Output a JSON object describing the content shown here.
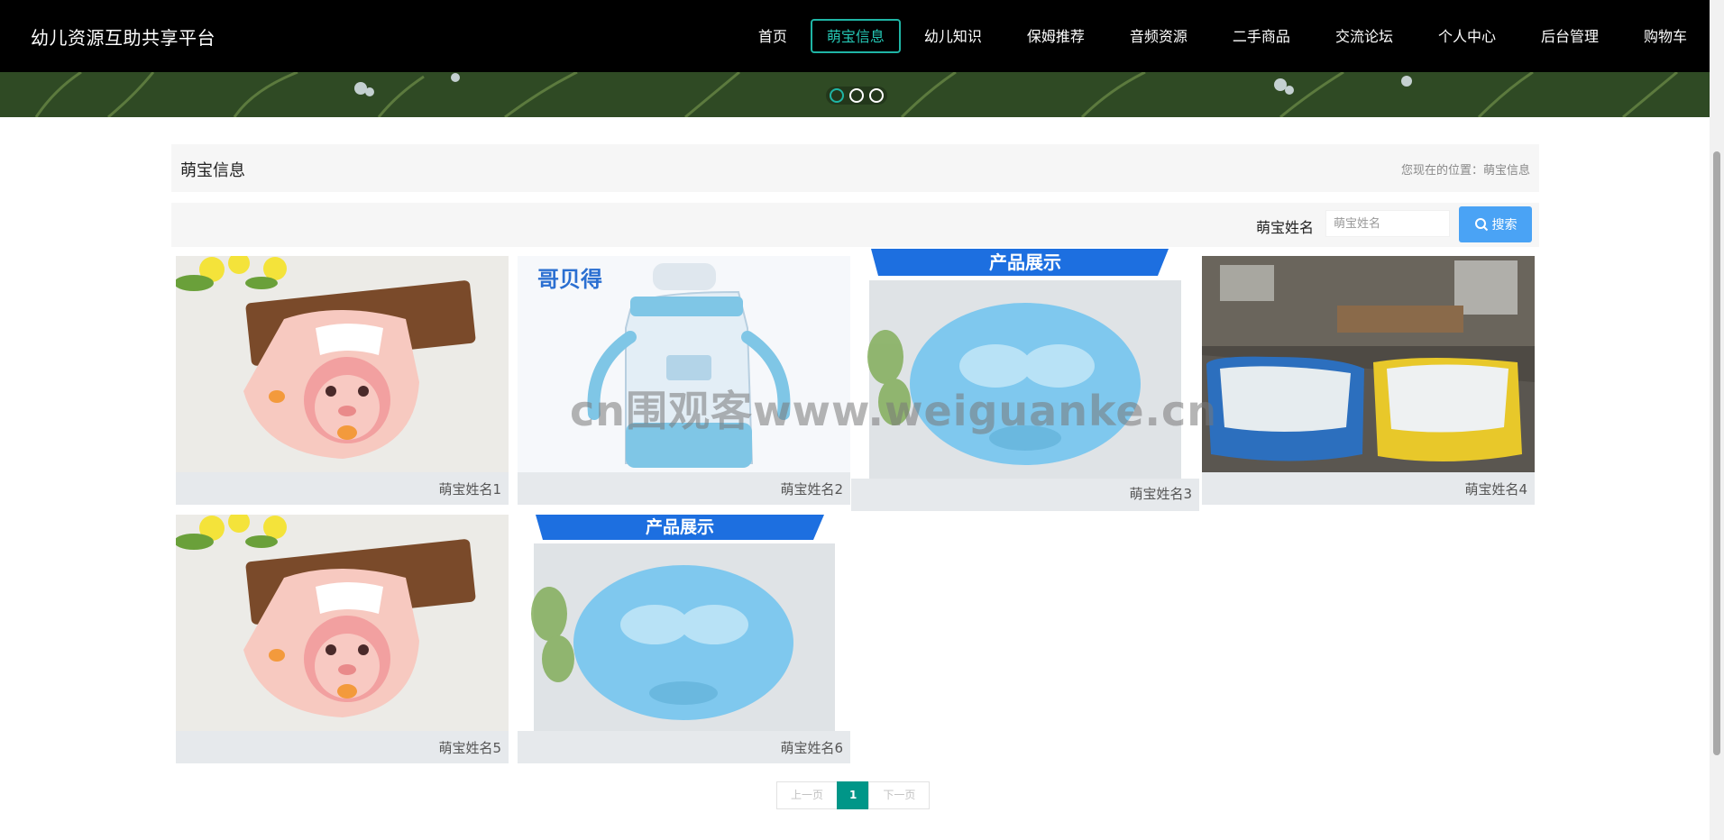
{
  "header": {
    "site_title": "幼儿资源互助共享平台",
    "nav": [
      {
        "label": "首页",
        "active": false
      },
      {
        "label": "萌宝信息",
        "active": true
      },
      {
        "label": "幼儿知识",
        "active": false
      },
      {
        "label": "保姆推荐",
        "active": false
      },
      {
        "label": "音频资源",
        "active": false
      },
      {
        "label": "二手商品",
        "active": false
      },
      {
        "label": "交流论坛",
        "active": false
      },
      {
        "label": "个人中心",
        "active": false
      },
      {
        "label": "后台管理",
        "active": false
      },
      {
        "label": "购物车",
        "active": false
      }
    ]
  },
  "banner": {
    "slide_count": 3,
    "active_slide": 1
  },
  "breadcrumb": {
    "title": "萌宝信息",
    "location": "您现在的位置：萌宝信息"
  },
  "search": {
    "label": "萌宝姓名",
    "placeholder": "萌宝姓名",
    "value": "",
    "button_label": "搜索"
  },
  "cards": [
    {
      "name": "萌宝姓名1",
      "image": "monkey-bib"
    },
    {
      "name": "萌宝姓名2",
      "image": "baby-bottle",
      "brand": "哥贝得"
    },
    {
      "name": "萌宝姓名3",
      "image": "shower-cap",
      "banner_text": "产品展示"
    },
    {
      "name": "萌宝姓名4",
      "image": "baby-tubs"
    },
    {
      "name": "萌宝姓名5",
      "image": "monkey-bib"
    },
    {
      "name": "萌宝姓名6",
      "image": "shower-cap",
      "banner_text": "产品展示"
    }
  ],
  "watermark": "cn围观客www.weiguanke.cn",
  "pagination": {
    "prev": "上一页",
    "current": "1",
    "next": "下一页"
  },
  "colors": {
    "nav_bg": "#000000",
    "accent": "#1fb5a5",
    "search_button": "#4aa3f5",
    "pager_active": "#009688",
    "card_caption_bg": "#e6e9ec"
  }
}
